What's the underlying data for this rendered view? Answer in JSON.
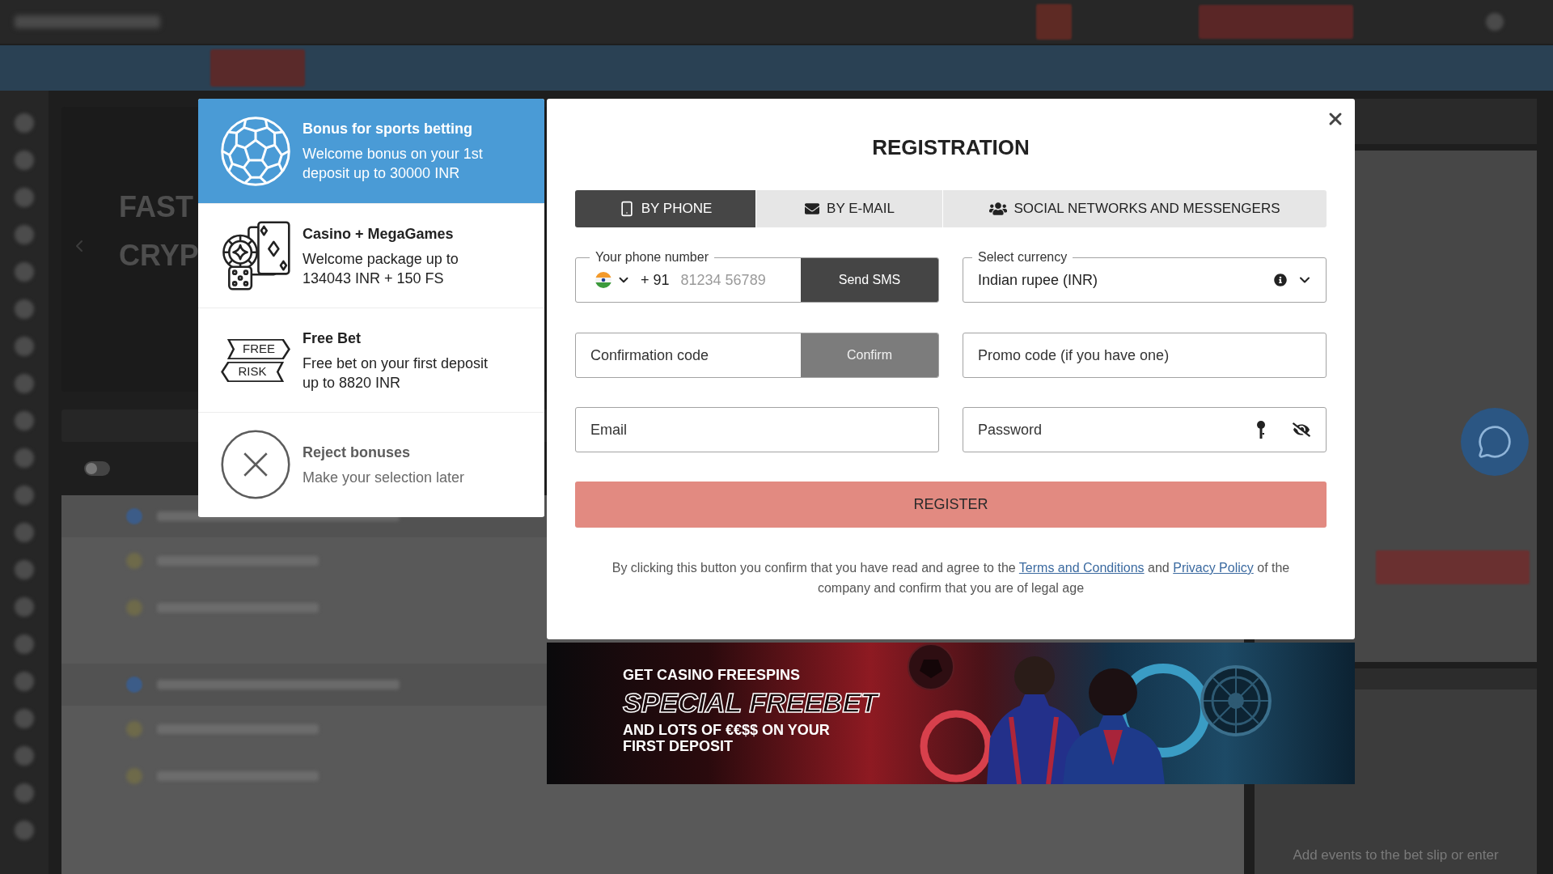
{
  "background": {
    "hero_lines": [
      "FAST",
      "CRYP"
    ],
    "toggle": {
      "on": false
    },
    "bet_slip_hint": "Add events to the bet slip or enter"
  },
  "bonuses": [
    {
      "kind": "sports",
      "title": "Bonus for sports betting",
      "description": "Welcome bonus on your 1st deposit up to 30000 INR",
      "selected": true
    },
    {
      "kind": "casino",
      "title": "Casino + MegaGames",
      "description": "Welcome package up to 134043 INR + 150 FS",
      "selected": false
    },
    {
      "kind": "freebet",
      "icon_labels": [
        "FREE",
        "RISK"
      ],
      "title": "Free Bet",
      "description": "Free bet on your first deposit up to 8820 INR",
      "selected": false
    },
    {
      "kind": "reject",
      "title": "Reject bonuses",
      "description": "Make your selection later",
      "selected": false
    }
  ],
  "dialog": {
    "title": "REGISTRATION",
    "tabs": [
      {
        "kind": "phone",
        "label": "BY PHONE",
        "selected": true
      },
      {
        "kind": "email",
        "label": "BY E-MAIL",
        "selected": false
      },
      {
        "kind": "social",
        "label": "SOCIAL NETWORKS AND MESSENGERS",
        "selected": false
      }
    ],
    "phone": {
      "label": "Your phone number",
      "dial_code": "+ 91",
      "placeholder": "81234 56789",
      "button": "Send SMS"
    },
    "currency": {
      "label": "Select currency",
      "value": "Indian rupee (INR)"
    },
    "confirmation": {
      "placeholder": "Confirmation code",
      "button": {
        "label": "Confirm",
        "disabled": true
      }
    },
    "promo": {
      "placeholder": "Promo code (if you have one)"
    },
    "email": {
      "placeholder": "Email"
    },
    "password": {
      "placeholder": "Password"
    },
    "register": {
      "label": "REGISTER",
      "disabled": true
    },
    "consent": [
      {
        "kind": "text",
        "text": "By clicking this button you confirm that you have read and agree to the "
      },
      {
        "kind": "link",
        "text": "Terms and Conditions"
      },
      {
        "kind": "text",
        "text": " and "
      },
      {
        "kind": "link",
        "text": "Privacy Policy"
      },
      {
        "kind": "text",
        "text": " of the company and confirm that you are of legal age"
      }
    ]
  },
  "banner": {
    "kicker": "GET CASINO FREESPINS",
    "headline": "SPECIAL FREEBET",
    "subline": "AND LOTS OF €€$$ ON YOUR FIRST DEPOSIT"
  }
}
